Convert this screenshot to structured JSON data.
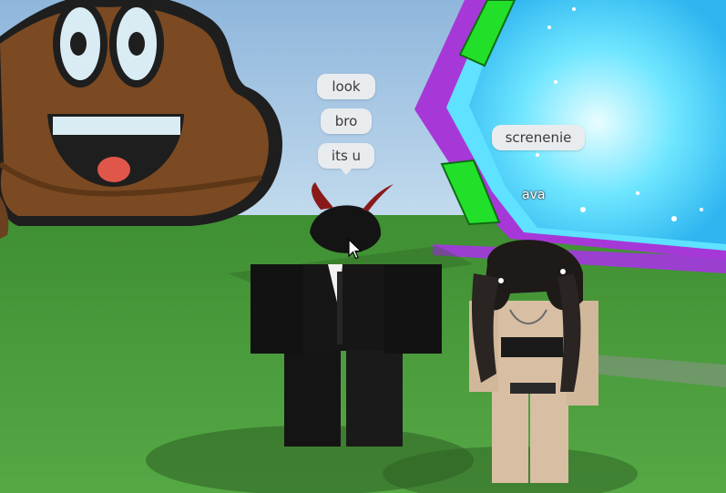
{
  "player_chat": {
    "messages": [
      "look",
      "bro",
      "its u"
    ]
  },
  "other_player": {
    "chat_message": "screnenie",
    "name_tag": "ava"
  },
  "colors": {
    "sky": "#a9c9e6",
    "grass": "#4a9a3c",
    "portal_purple": "#a638d8",
    "portal_glow": "#5fe2ff",
    "portal_green": "#22e02a",
    "poop_brown": "#7b4a22",
    "bubble_bg": "#e9ecef"
  },
  "icons": [
    "poop-emoji-sign",
    "neon-portal",
    "mouse-cursor-icon"
  ]
}
